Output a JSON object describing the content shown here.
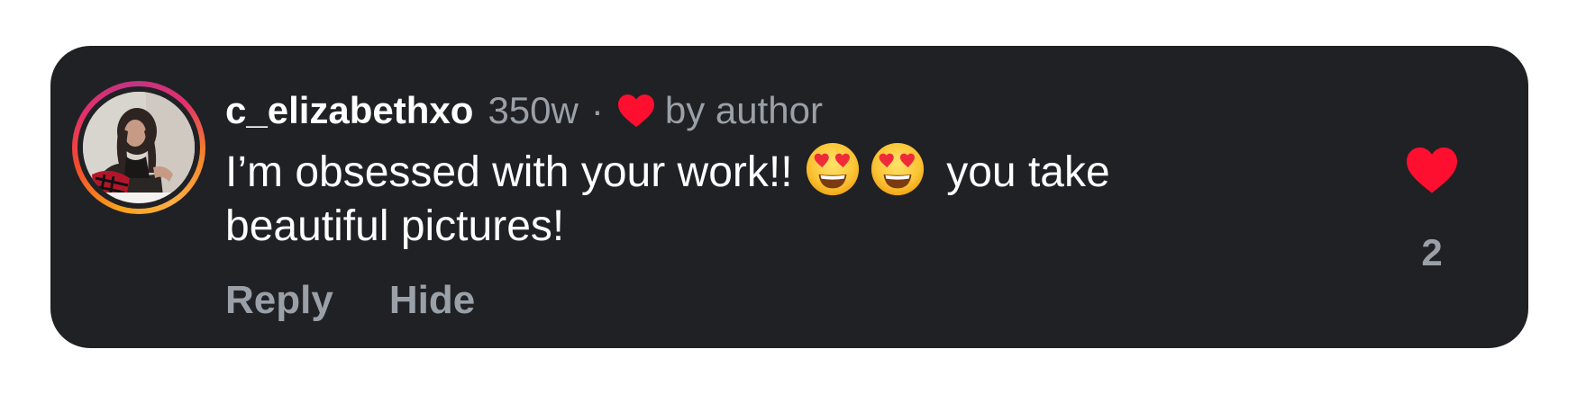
{
  "comment": {
    "username": "c_elizabethxo",
    "time": "350w",
    "separator": "·",
    "author_like_label": "by author",
    "text_part1": "I’m obsessed with your work!! ",
    "emojis": [
      "smiling-face-with-heart-eyes",
      "smiling-face-with-heart-eyes"
    ],
    "text_part2": " you take beautiful pictures!",
    "actions": {
      "reply_label": "Reply",
      "hide_label": "Hide"
    },
    "like_count": "2",
    "liked": true
  },
  "colors": {
    "card_background": "#202124",
    "text_primary": "#ffffff",
    "text_secondary": "#9aa0a8",
    "heart_red": "#ff0f2f"
  },
  "icons": {
    "author_heart": "heart-icon",
    "like_heart": "heart-icon",
    "emoji": "heart-eyes-emoji-icon"
  }
}
